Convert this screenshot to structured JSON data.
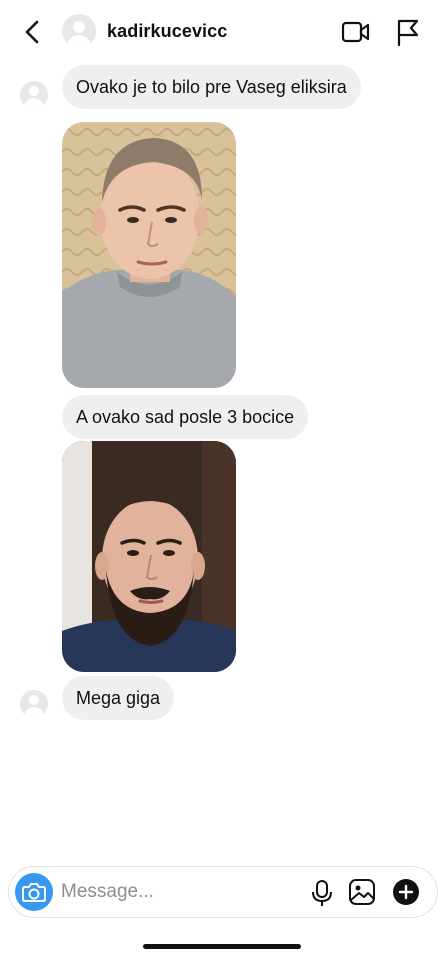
{
  "header": {
    "username": "kadirkucevicc",
    "back_icon": "chevron-left-icon",
    "video_icon": "video-camera-icon",
    "flag_icon": "flag-icon"
  },
  "messages": [
    {
      "type": "text",
      "text": "Ovako je to bilo pre Vaseg eliksira"
    },
    {
      "type": "photo",
      "description_icon": "before-photo"
    },
    {
      "type": "text",
      "text": "A ovako sad posle 3 bocice"
    },
    {
      "type": "photo",
      "description_icon": "after-photo"
    },
    {
      "type": "text",
      "text": "Mega giga"
    }
  ],
  "composer": {
    "placeholder": "Message...",
    "camera_icon": "camera-icon",
    "mic_icon": "microphone-icon",
    "gallery_icon": "gallery-icon",
    "add_icon": "plus-circle-icon"
  },
  "colors": {
    "bubble": "#efefef",
    "camera_button": "#3897f0",
    "text": "#111111"
  }
}
